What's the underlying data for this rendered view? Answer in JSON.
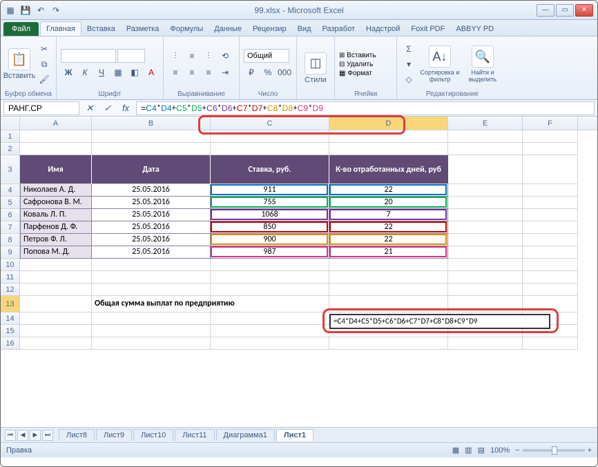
{
  "window": {
    "title": "99.xlsx - Microsoft Excel"
  },
  "qat": {
    "excel": "⊞",
    "save": "💾",
    "undo": "↶",
    "redo": "↷"
  },
  "tabs": {
    "file": "Файл",
    "items": [
      "Главная",
      "Вставка",
      "Разметка",
      "Формулы",
      "Данные",
      "Рецензир",
      "Вид",
      "Разработ",
      "Надстрой",
      "Foxit PDF",
      "ABBYY PD"
    ],
    "active": 0
  },
  "ribbon": {
    "clipboard": {
      "paste": "Вставить",
      "label": "Буфер обмена"
    },
    "font": {
      "label": "Шрифт",
      "bold": "Ж",
      "italic": "К",
      "underline": "Ч"
    },
    "align": {
      "label": "Выравнивание"
    },
    "number": {
      "format": "Общий",
      "label": "Число"
    },
    "styles": {
      "btn": "Стили"
    },
    "cells": {
      "insert": "Вставить",
      "delete": "Удалить",
      "format": "Формат",
      "label": "Ячейки"
    },
    "editing": {
      "sigma": "Σ",
      "sort": "Сортировка и фильтр",
      "find": "Найти и выделить",
      "label": "Редактирование"
    }
  },
  "formulabar": {
    "name": "РАНГ.СР",
    "formula_plain": "=C4*D4+C5*D5+C6*D6+C7*D7+C8*D8+C9*D9"
  },
  "columns": [
    "A",
    "B",
    "C",
    "D",
    "E",
    "F"
  ],
  "row_numbers": [
    "1",
    "2",
    "3",
    "4",
    "5",
    "6",
    "7",
    "8",
    "9",
    "10",
    "11",
    "12",
    "13",
    "14",
    "15",
    "16"
  ],
  "table": {
    "headers": {
      "name": "Имя",
      "date": "Дата",
      "rate": "Ставка, руб.",
      "days": "К-во отработанных дней, руб"
    },
    "rows": [
      {
        "name": "Николаев А. Д.",
        "date": "25.05.2016",
        "rate": "911",
        "days": "22"
      },
      {
        "name": "Сафронова В. М.",
        "date": "25.05.2016",
        "rate": "755",
        "days": "20"
      },
      {
        "name": "Коваль Л. П.",
        "date": "25.05.2016",
        "rate": "1068",
        "days": "7"
      },
      {
        "name": "Парфенов Д. Ф.",
        "date": "25.05.2016",
        "rate": "850",
        "days": "22"
      },
      {
        "name": "Петров Ф. Л.",
        "date": "25.05.2016",
        "rate": "900",
        "days": "22"
      },
      {
        "name": "Попова М. Д.",
        "date": "25.05.2016",
        "rate": "987",
        "days": "21"
      }
    ]
  },
  "summary": {
    "label": "Общая сумма выплат по предприятию",
    "cell_display": "=C4*D4+C5*D5+C6*D6+C7*D7+C8*D8+C9*D9"
  },
  "sheets": {
    "list": [
      "Лист8",
      "Лист9",
      "Лист10",
      "Лист11",
      "Диаграмма1",
      "Лист1"
    ],
    "active": 5
  },
  "status": {
    "mode": "Правка",
    "zoom": "100%"
  }
}
